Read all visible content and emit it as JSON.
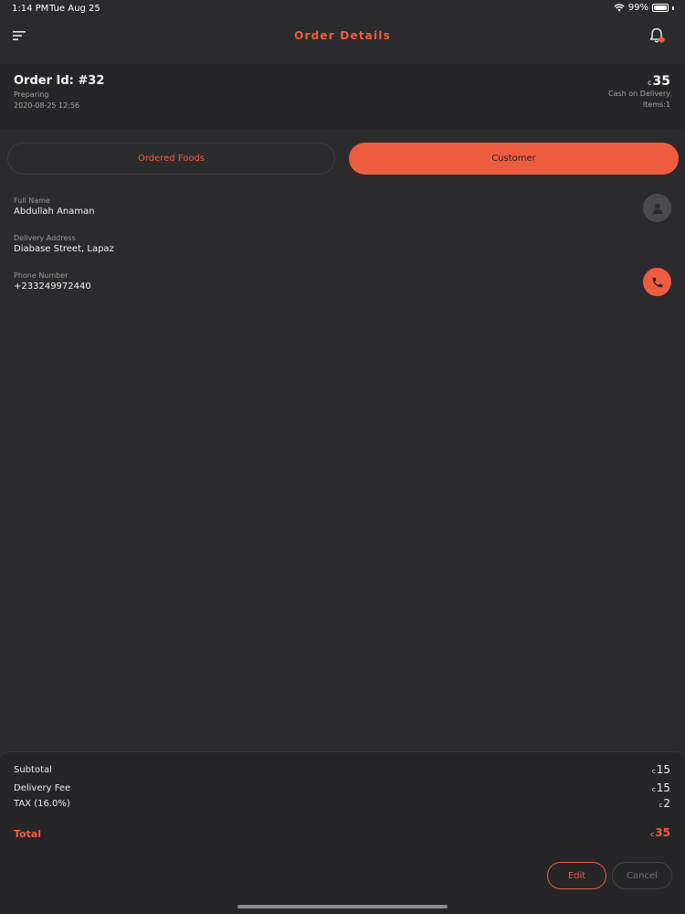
{
  "status_bar": {
    "time": "1:14 PM",
    "date": "Tue Aug 25",
    "battery": "99%",
    "battery_level": 0.99
  },
  "nav": {
    "title": "Order Details"
  },
  "order": {
    "id": "Order Id: #32",
    "status": "Preparing",
    "datetime": "2020-08-25 12:56",
    "currency": "c",
    "amount": "35",
    "payment": "Cash on Delivery",
    "items": "Items:1"
  },
  "tabs": [
    {
      "label": "Ordered Foods",
      "active": false
    },
    {
      "label": "Customer",
      "active": true
    }
  ],
  "customer": {
    "full_name_label": "Full Name",
    "full_name": "Abdullah Anaman",
    "address_label": "Delivery Address",
    "address": "Diabase Street, Lapaz",
    "phone_label": "Phone Number",
    "phone": "+233249972440"
  },
  "summary": {
    "currency": "c",
    "subtotal_label": "Subtotal",
    "subtotal": "15",
    "delivery_label": "Delivery Fee",
    "delivery": "15",
    "tax_label": "TAX (16.0%)",
    "tax": "2",
    "total_label": "Total",
    "total": "35",
    "edit_label": "Edit",
    "cancel_label": "Cancel"
  },
  "colors": {
    "accent": "#ee5c40",
    "background": "#2b2b2d",
    "panel": "#262628"
  },
  "icons": {
    "menu": "menu-icon",
    "bell": "bell-icon",
    "person": "person-icon",
    "phone": "phone-icon",
    "wifi": "wifi-icon",
    "battery": "battery-icon"
  }
}
